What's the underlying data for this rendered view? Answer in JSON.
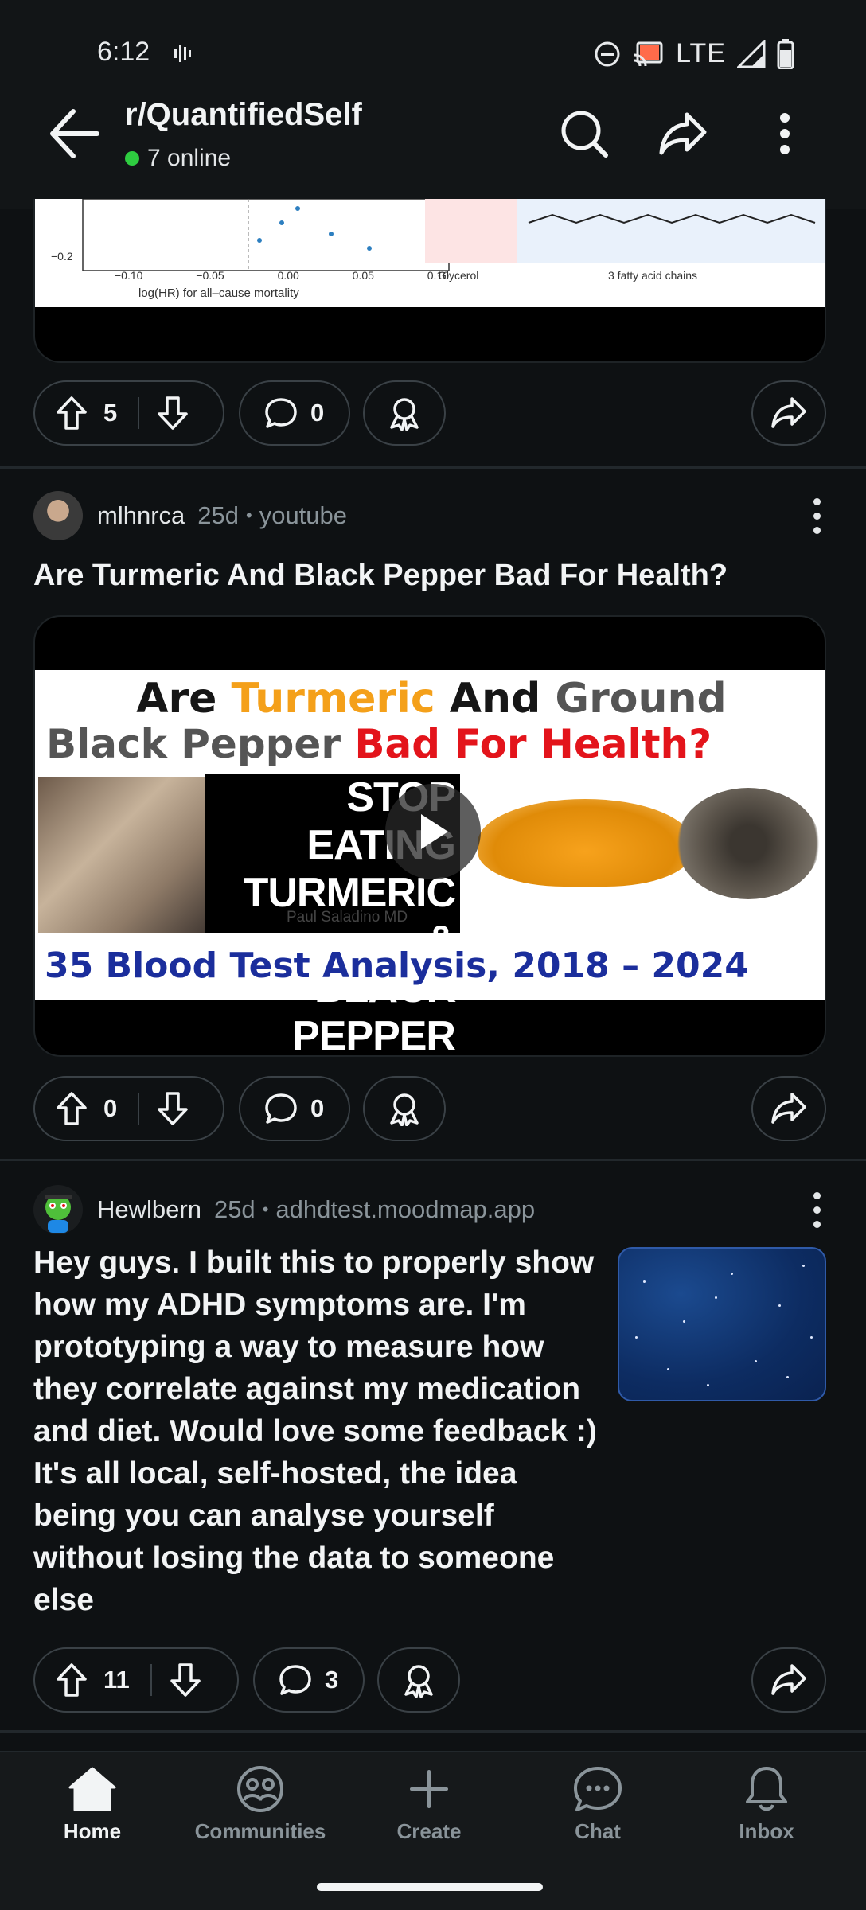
{
  "status_bar": {
    "time": "6:12",
    "network": "LTE"
  },
  "header": {
    "subreddit": "r/QuantifiedSelf",
    "online": "7 online",
    "online_color": "#2ecc40"
  },
  "top_media_fragment": {
    "axis_label": "log(HR) for all–cause mortality",
    "ticks": [
      "−0.10",
      "−0.05",
      "0.00",
      "0.05",
      "0.10"
    ],
    "y_tick": "−0.2",
    "molecule_labels": [
      "Glycerol",
      "3 fatty acid chains"
    ]
  },
  "posts": [
    {
      "upvotes": "5",
      "comments": "0"
    },
    {
      "author": "mlhnrca",
      "age": "25d",
      "source": "youtube",
      "title": "Are Turmeric And Black Pepper Bad For Health?",
      "thumbnail": {
        "line1_a": "Are ",
        "line1_b": "Turmeric",
        "line1_c": " And ",
        "line1_d": "Ground",
        "line2_a": "Black Pepper ",
        "line2_b": "Bad For Health?",
        "stop_lines": [
          "STOP EATING",
          "TURMERIC &",
          "BLACK PEPPER"
        ],
        "presenter": "Paul Saladino MD",
        "bottom": "35 Blood Test Analysis, 2018 – 2024"
      },
      "upvotes": "0",
      "comments": "0"
    },
    {
      "author": "Hewlbern",
      "age": "25d",
      "source": "adhdtest.moodmap.app",
      "title": "Hey guys. I built this to properly show how my ADHD symptoms are. I'm prototyping a way to measure how they correlate against my medication and diet. Would love some feedback :) It's all local, self-hosted, the idea being you can analyse yourself without losing the data to someone else",
      "upvotes": "11",
      "comments": "3"
    }
  ],
  "bottom_nav": [
    {
      "label": "Home",
      "icon": "home-icon",
      "active": true
    },
    {
      "label": "Communities",
      "icon": "communities-icon",
      "active": false
    },
    {
      "label": "Create",
      "icon": "plus-icon",
      "active": false
    },
    {
      "label": "Chat",
      "icon": "chat-icon",
      "active": false
    },
    {
      "label": "Inbox",
      "icon": "bell-icon",
      "active": false
    }
  ]
}
